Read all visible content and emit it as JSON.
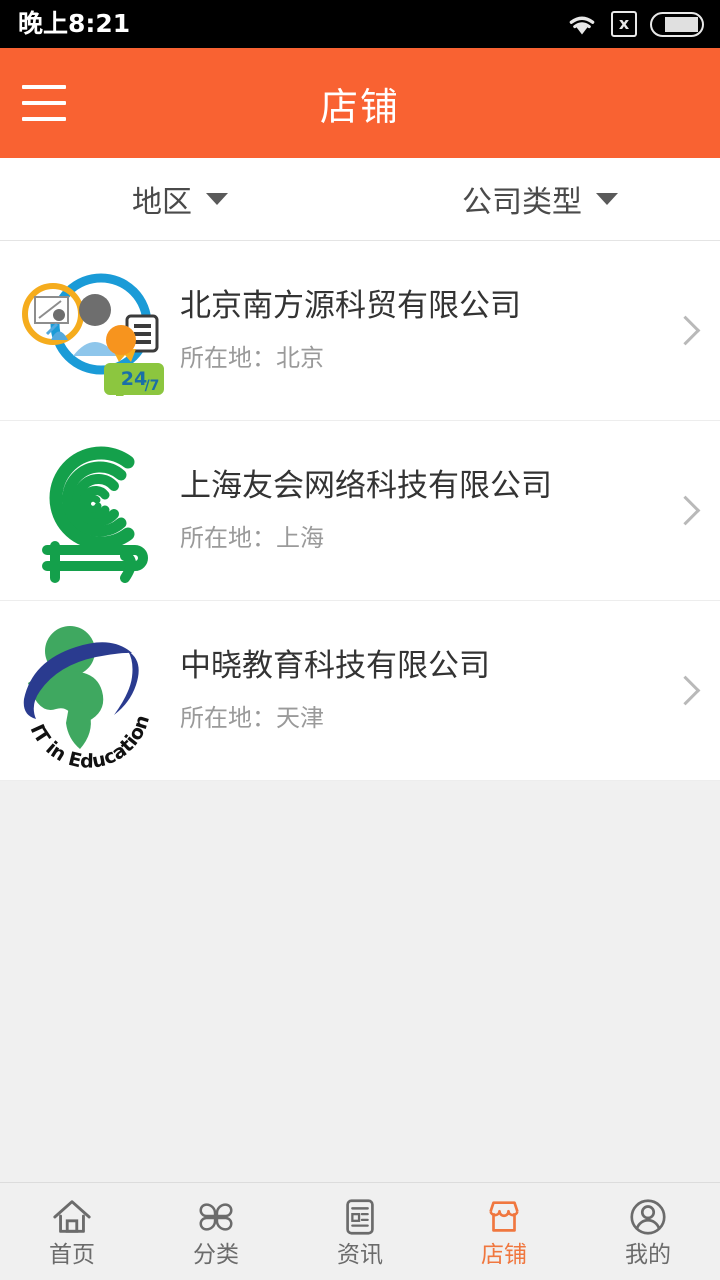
{
  "status_bar": {
    "time": "晚上8:21",
    "icons": [
      "wifi-icon",
      "sim-no-service-icon",
      "battery-icon"
    ],
    "battery_level": "65"
  },
  "header": {
    "title": "店铺",
    "menu_icon": "hamburger-menu-icon",
    "background_color": "#f96232"
  },
  "filters": [
    {
      "label": "地区",
      "icon": "chevron-down-icon"
    },
    {
      "label": "公司类型",
      "icon": "chevron-down-icon"
    }
  ],
  "shops": [
    {
      "name": "北京南方源科贸有限公司",
      "location": "所在地：北京",
      "logo": "training-people-24-7-logo",
      "chevron": "chevron-right-icon"
    },
    {
      "name": "上海友会网络科技有限公司",
      "location": "所在地：上海",
      "logo": "green-spiral-scroll-logo",
      "chevron": "chevron-right-icon"
    },
    {
      "name": "中晓教育科技有限公司",
      "location": "所在地：天津",
      "logo": "it-in-education-logo",
      "logo_text": "IT in Education",
      "chevron": "chevron-right-icon"
    }
  ],
  "bottom_nav": {
    "active_color": "#f0773f",
    "inactive_color": "#6b6b6b",
    "items": [
      {
        "label": "首页",
        "icon": "home-icon",
        "active": false
      },
      {
        "label": "分类",
        "icon": "clover-grid-icon",
        "active": false
      },
      {
        "label": "资讯",
        "icon": "news-document-icon",
        "active": false
      },
      {
        "label": "店铺",
        "icon": "shop-icon",
        "active": true
      },
      {
        "label": "我的",
        "icon": "user-profile-icon",
        "active": false
      }
    ]
  }
}
